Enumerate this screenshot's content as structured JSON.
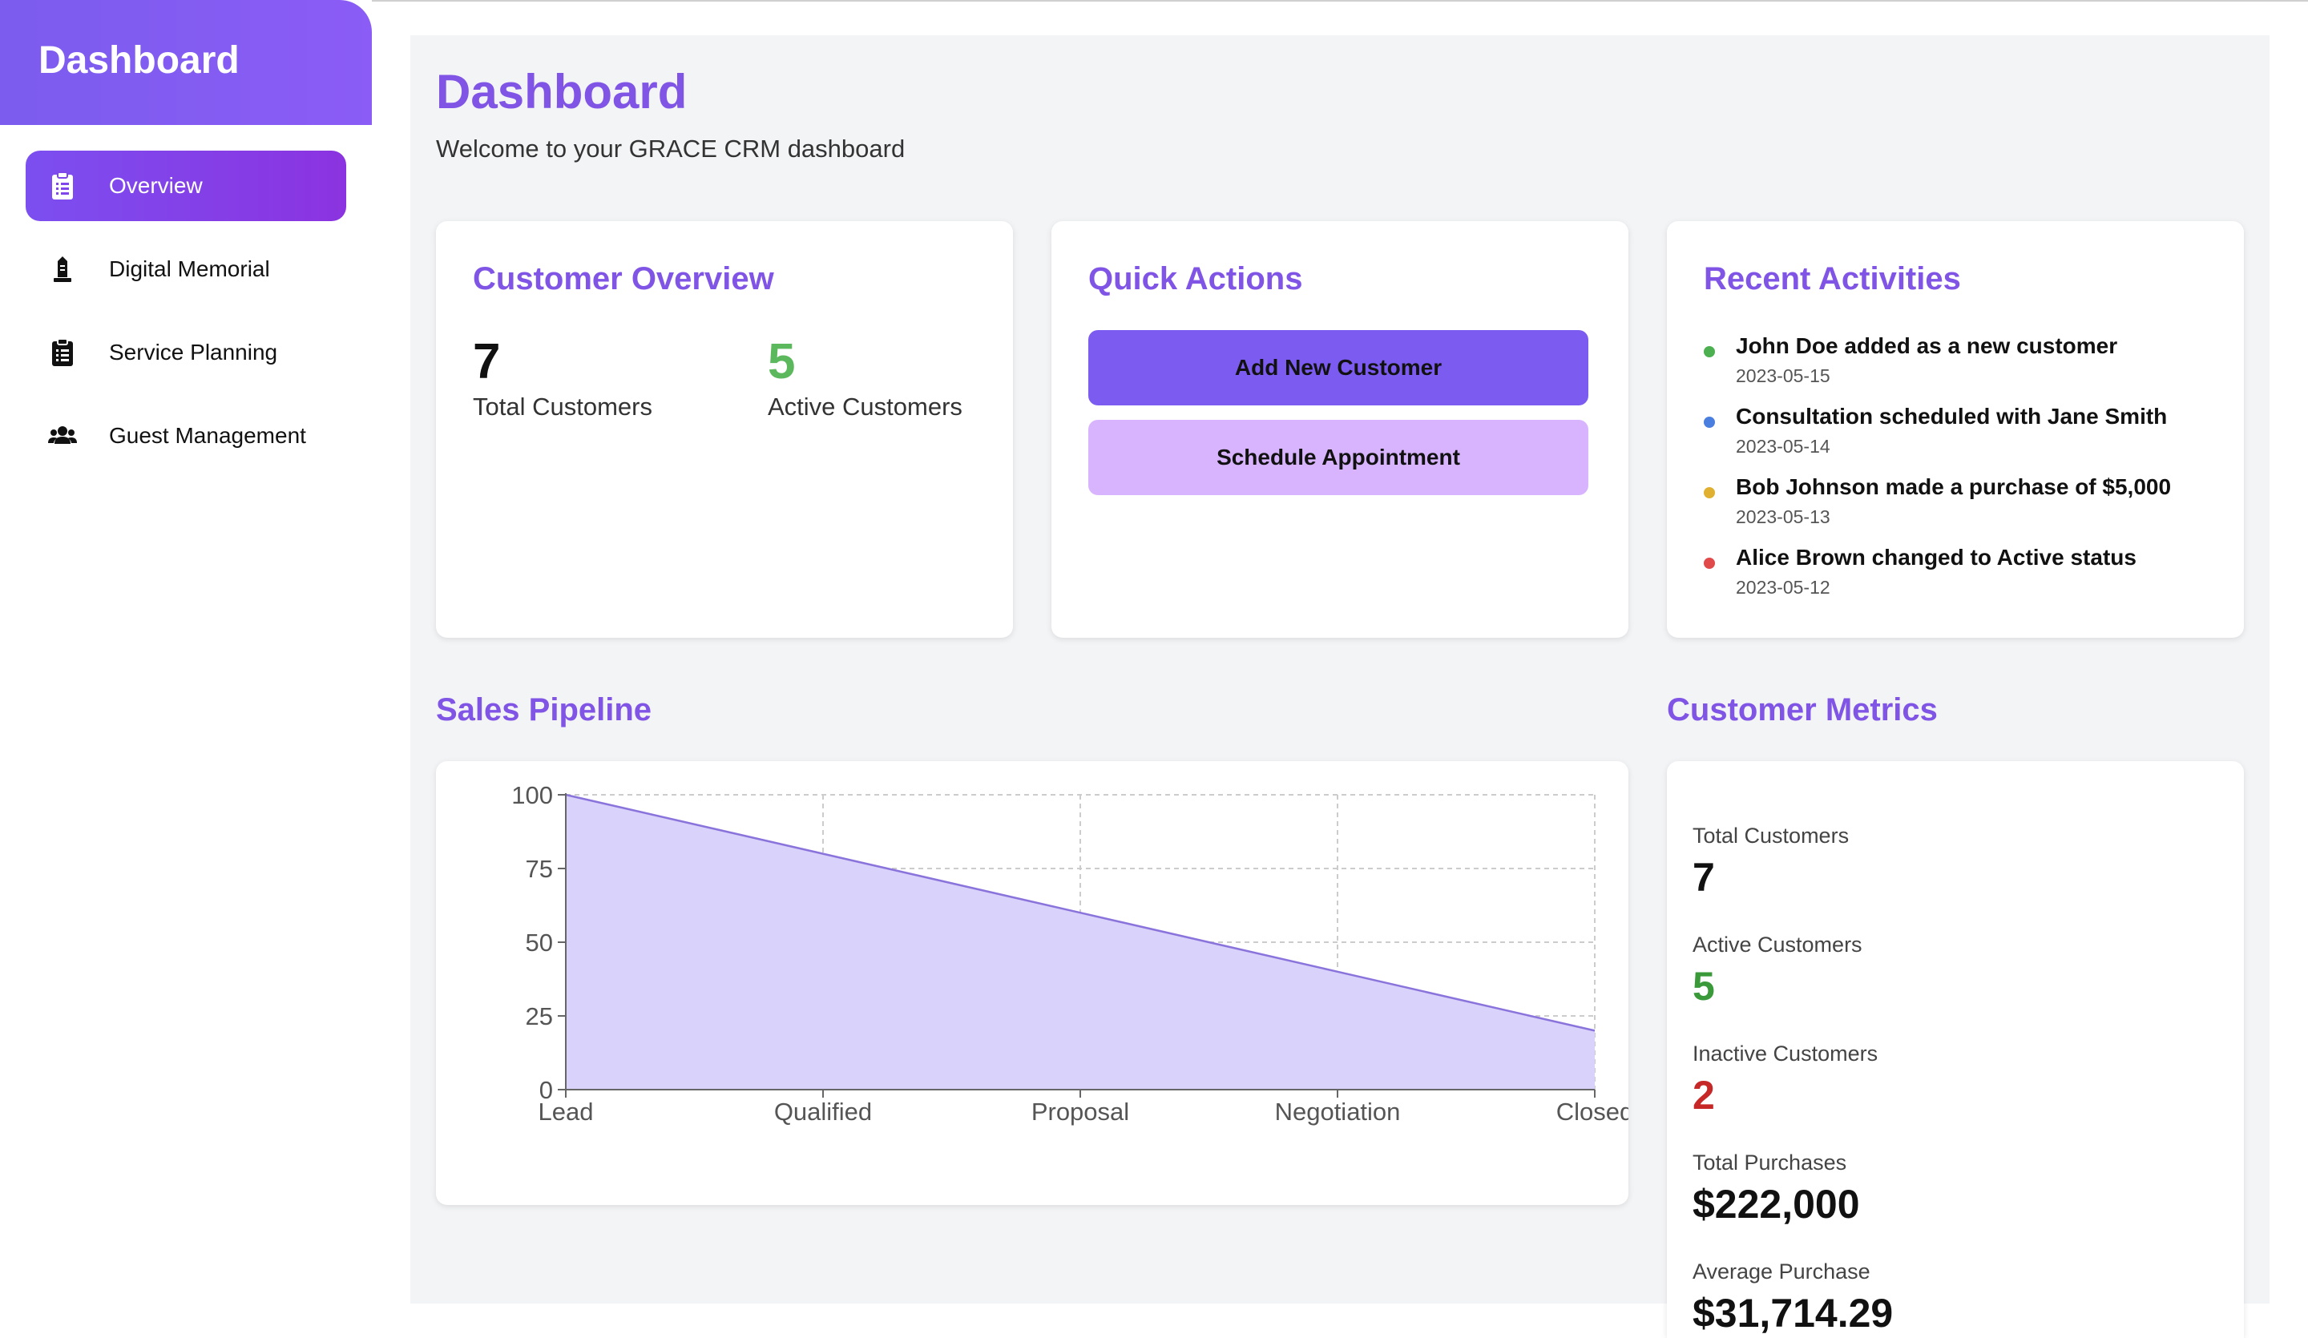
{
  "sidebar": {
    "title": "Dashboard",
    "items": [
      {
        "label": "Overview",
        "icon": "clipboard-list-icon",
        "active": true
      },
      {
        "label": "Digital Memorial",
        "icon": "monument-icon",
        "active": false
      },
      {
        "label": "Service Planning",
        "icon": "clipboard-list-icon",
        "active": false
      },
      {
        "label": "Guest Management",
        "icon": "users-icon",
        "active": false
      }
    ]
  },
  "header": {
    "title": "Dashboard",
    "subtitle": "Welcome to your GRACE CRM dashboard"
  },
  "customer_overview": {
    "title": "Customer Overview",
    "total_value": "7",
    "total_label": "Total Customers",
    "active_value": "5",
    "active_label": "Active Customers"
  },
  "quick_actions": {
    "title": "Quick Actions",
    "add_label": "Add New Customer",
    "schedule_label": "Schedule Appointment"
  },
  "recent_activities": {
    "title": "Recent Activities",
    "items": [
      {
        "text": "John Doe added as a new customer",
        "date": "2023-05-15",
        "color": "#4caf50"
      },
      {
        "text": "Consultation scheduled with Jane Smith",
        "date": "2023-05-14",
        "color": "#4a7fe0"
      },
      {
        "text": "Bob Johnson made a purchase of $5,000",
        "date": "2023-05-13",
        "color": "#e0b030"
      },
      {
        "text": "Alice Brown changed to Active status",
        "date": "2023-05-12",
        "color": "#e04a4a"
      }
    ]
  },
  "sales_pipeline": {
    "title": "Sales Pipeline"
  },
  "chart_data": {
    "type": "area",
    "categories": [
      "Lead",
      "Qualified",
      "Proposal",
      "Negotiation",
      "Closed"
    ],
    "values": [
      100,
      80,
      60,
      40,
      20
    ],
    "yticks": [
      0,
      25,
      50,
      75,
      100
    ],
    "ylim": [
      0,
      100
    ],
    "grid": true,
    "fill_color": "#d9d2fb",
    "line_color": "#8a74dc"
  },
  "customer_metrics": {
    "title": "Customer Metrics",
    "items": [
      {
        "label": "Total Customers",
        "value": "7",
        "color": "#111111"
      },
      {
        "label": "Active Customers",
        "value": "5",
        "color": "#3a9a3a"
      },
      {
        "label": "Inactive Customers",
        "value": "2",
        "color": "#c62828"
      },
      {
        "label": "Total Purchases",
        "value": "$222,000",
        "color": "#111111"
      },
      {
        "label": "Average Purchase",
        "value": "$31,714.29",
        "color": "#111111"
      }
    ]
  },
  "colors": {
    "accent": "#8055e6",
    "active_green": "#5cb85c"
  }
}
